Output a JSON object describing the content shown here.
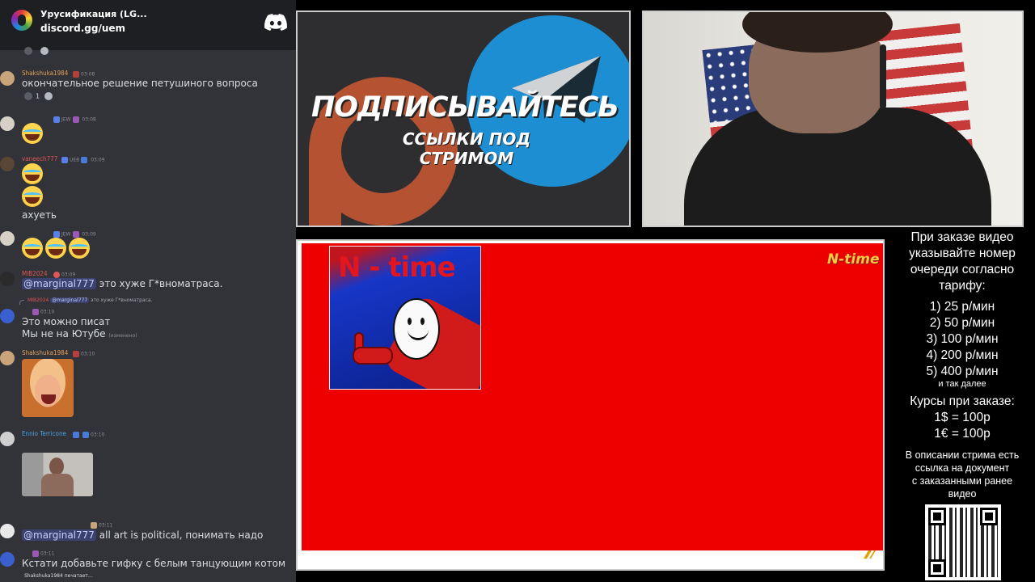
{
  "chat": {
    "server_name": "Урусификация (LG...",
    "server_invite": "discord.gg/uem",
    "typing": "Shakshuka1984 печатает…",
    "messages": [
      {
        "user": "Shakshuka1984",
        "user_color": "#e3a15c",
        "time": "03:08",
        "text": "окончательное решение петушиного вопроса",
        "reaction_count": "1"
      },
      {
        "user": "",
        "tag": "JEW",
        "time": "03:08",
        "emoji_count": 1
      },
      {
        "user": "vaneech777",
        "user_color": "#e05555",
        "tag": "UEB",
        "time": "03:09",
        "emoji_count": 2,
        "text": "ахуеть"
      },
      {
        "user": "",
        "tag": "JEW",
        "time": "03:09",
        "emoji_count": 3
      },
      {
        "user": "MIB2024",
        "user_color": "#e05555",
        "time": "03:09",
        "mention": "@marginal777",
        "text": "это хуже Г*вноматраса."
      },
      {
        "reply_user": "MIB2024",
        "reply_mention": "@marginal777",
        "reply_text": "это хуже Г*вноматраса.",
        "time": "03:10",
        "text_line1": "Это можно писат",
        "text_line2": "Мы не на Ютубе",
        "edited": "(изменено)"
      },
      {
        "user": "Shakshuka1984",
        "user_color": "#e3a15c",
        "time": "03:10"
      },
      {
        "user": "Ennio Terricone",
        "user_color": "#4fa3e3",
        "time": "03:10"
      },
      {
        "time": "03:11",
        "mention": "@marginal777",
        "text": "all art is political, понимать надо"
      },
      {
        "time": "03:11",
        "text": "Кстати добавьте гифку с белым танцующим котом"
      }
    ]
  },
  "promo": {
    "title": "ПОДПИСЫВАЙТЕСЬ",
    "subtitle": "ССЫЛКИ ПОД СТРИМОМ"
  },
  "media": {
    "image_title": "N - time",
    "logo": "N-time"
  },
  "info": {
    "order_line1": "При заказе видео",
    "order_line2": "указывайте номер",
    "order_line3": "очереди согласно",
    "order_line4": "тарифу:",
    "tariffs": [
      "1) 25 р/мин",
      "2) 50 р/мин",
      "3) 100 р/мин",
      "4) 200 р/мин",
      "5) 400 р/мин"
    ],
    "etc": "и так далее",
    "rates_title": "Курсы при заказе:",
    "rate_usd": "1$ = 100р",
    "rate_eur": "1€ = 100р",
    "desc_line1": "В описании стрима есть",
    "desc_line2": "ссылка на документ",
    "desc_line3": "с заказанными ранее",
    "desc_line4": "видео"
  },
  "colors": {
    "discord_bg": "#313338",
    "discord_header": "#1e1f22",
    "media_red": "#ee0000",
    "telegram_blue": "#1d8ed1",
    "patreon_orange": "#b45232"
  }
}
